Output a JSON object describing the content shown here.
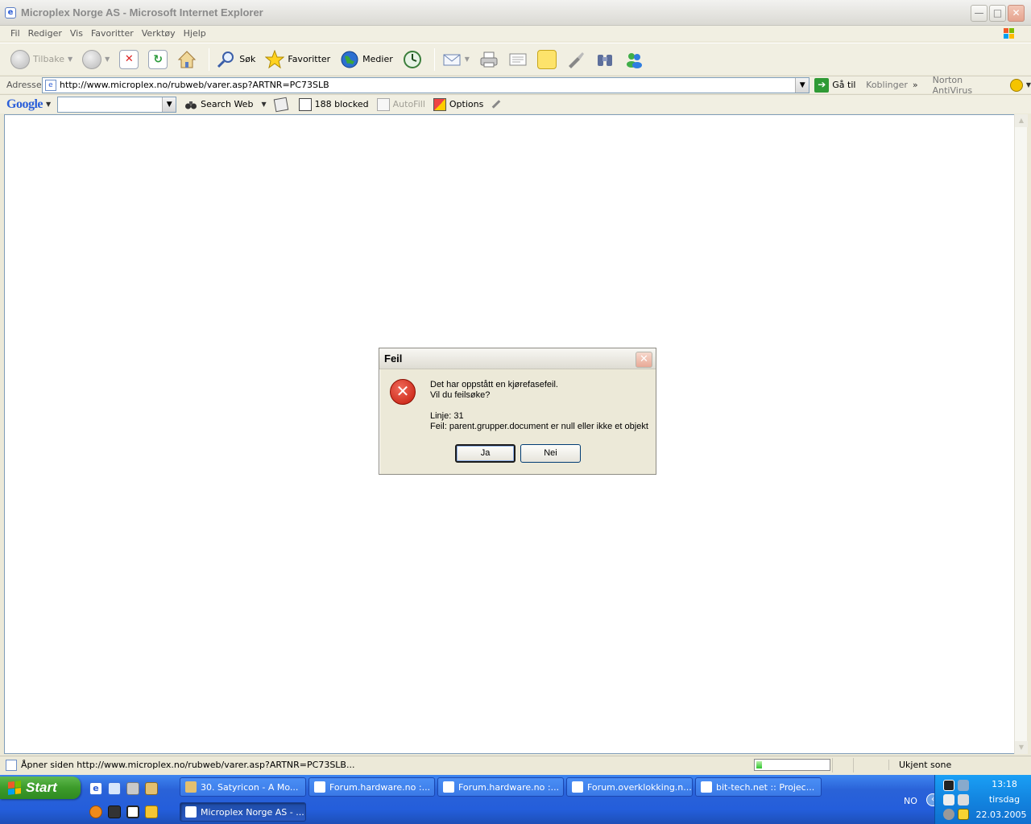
{
  "window": {
    "title": "Microplex Norge AS - Microsoft Internet Explorer",
    "min": "—",
    "max": "□",
    "close": "✕"
  },
  "menu": [
    "Fil",
    "Rediger",
    "Vis",
    "Favoritter",
    "Verktøy",
    "Hjelp"
  ],
  "toolbar": {
    "back_label": "Tilbake",
    "search_label": "Søk",
    "favorites_label": "Favoritter",
    "media_label": "Medier"
  },
  "address": {
    "label": "Adresse",
    "url": "http://www.microplex.no/rubweb/varer.asp?ARTNR=PC73SLB",
    "go_label": "Gå til",
    "links_label": "Koblinger",
    "links_chevron": "»",
    "norton_label": "Norton AntiVirus"
  },
  "google": {
    "logo": "Google",
    "search_web": "Search Web",
    "blocked": "188 blocked",
    "autofill": "AutoFill",
    "options": "Options"
  },
  "dialog": {
    "title": "Feil",
    "line1": "Det har oppstått en kjørefasefeil.",
    "line2": "Vil du feilsøke?",
    "line3": "Linje: 31",
    "line4": "Feil: parent.grupper.document er null eller ikke et objekt",
    "yes": "Ja",
    "no": "Nei"
  },
  "status": {
    "text": "Åpner siden http://www.microplex.no/rubweb/varer.asp?ARTNR=PC73SLB...",
    "zone": "Ukjent sone",
    "progress_fraction": 0.08
  },
  "taskbar": {
    "start": "Start",
    "row1": [
      "30. Satyricon - A Mo...",
      "Forum.hardware.no :...",
      "Forum.hardware.no :...",
      "Forum.overklokking.n...",
      "bit-tech.net :: Projec..."
    ],
    "active": "Microplex Norge AS - ...",
    "lang": "NO",
    "time": "13:18",
    "day": "tirsdag",
    "date": "22.03.2005"
  },
  "colors": {
    "taskbar_blue": "#245edb",
    "start_green": "#3c9b2a",
    "tray_blue": "#1385e0",
    "error_red": "#c41a0b"
  }
}
